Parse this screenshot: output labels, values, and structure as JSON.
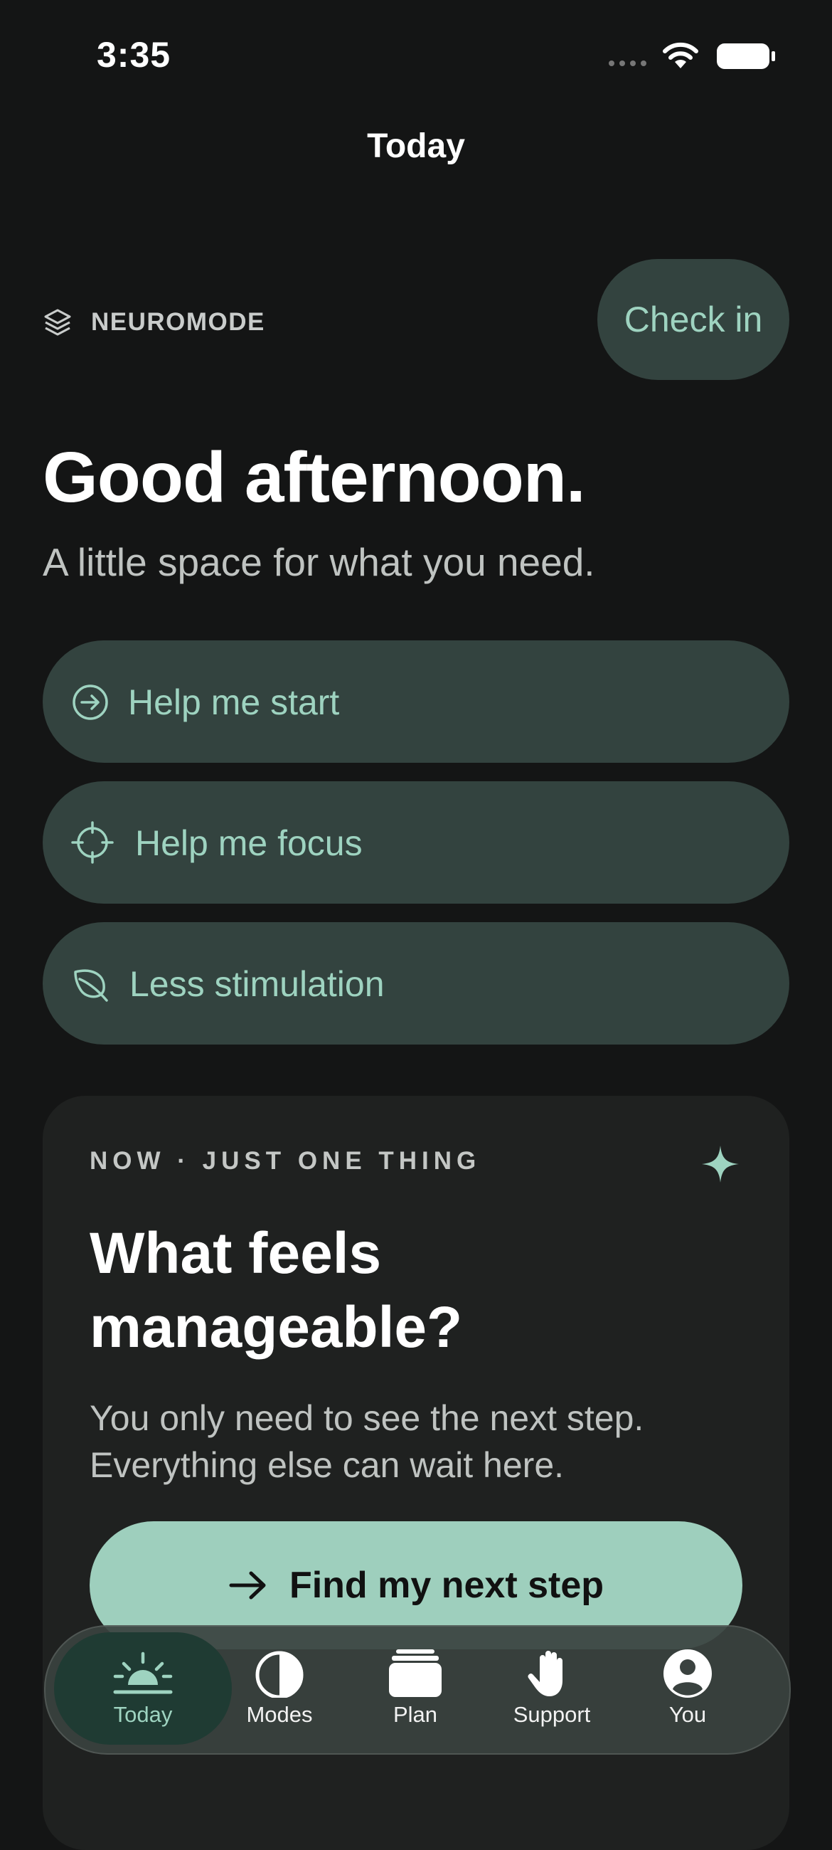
{
  "status_bar": {
    "time": "3:35"
  },
  "nav": {
    "title": "Today"
  },
  "brand": {
    "icon": "layers-icon",
    "label": "NEUROMODE"
  },
  "check_in": {
    "label": "Check in"
  },
  "greeting": {
    "title": "Good afternoon.",
    "subtitle": "A little space for what you need."
  },
  "actions": [
    {
      "icon": "arrow-circle-icon",
      "label": "Help me start"
    },
    {
      "icon": "crosshair-icon",
      "label": "Help me focus"
    },
    {
      "icon": "leaf-icon",
      "label": "Less stimulation"
    }
  ],
  "card": {
    "eyebrow": "NOW · JUST ONE THING",
    "title": "What feels manageable?",
    "body": "You only need to see the next step. Everything else can wait here.",
    "button_label": "Find my next step"
  },
  "tabs": [
    {
      "icon": "sunrise-icon",
      "label": "Today",
      "active": true
    },
    {
      "icon": "half-circle-icon",
      "label": "Modes"
    },
    {
      "icon": "stack-icon",
      "label": "Plan"
    },
    {
      "icon": "hand-icon",
      "label": "Support"
    },
    {
      "icon": "person-icon",
      "label": "You"
    }
  ],
  "colors": {
    "background": "#141515",
    "accent": "#9ed3c0",
    "pill": "#33433f",
    "button": "#9ecfbd"
  }
}
